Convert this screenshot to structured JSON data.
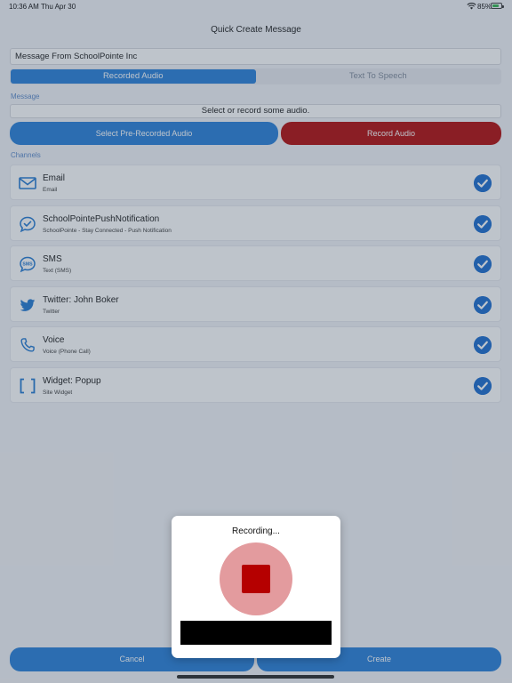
{
  "status_bar": {
    "time": "10:36 AM",
    "date": "Thu Apr 30",
    "battery": "85%"
  },
  "nav": {
    "title": "Quick Create Message"
  },
  "form": {
    "name_value": "Message From SchoolPointe Inc",
    "segments": [
      {
        "label": "Recorded Audio",
        "active": true
      },
      {
        "label": "Text To Speech",
        "active": false
      }
    ],
    "message_label": "Message",
    "audio_status": "Select or record some audio.",
    "select_button": "Select Pre-Recorded Audio",
    "record_button": "Record Audio",
    "channels_label": "Channels"
  },
  "channels": [
    {
      "icon": "envelope-icon",
      "title": "Email",
      "subtitle": "Email",
      "checked": true
    },
    {
      "icon": "chat-check-icon",
      "title": "SchoolPointePushNotification",
      "subtitle": "SchoolPointe - Stay Connected - Push Notification",
      "checked": true
    },
    {
      "icon": "sms-bubble-icon",
      "title": "SMS",
      "subtitle": "Text (SMS)",
      "checked": true
    },
    {
      "icon": "twitter-bird-icon",
      "title": "Twitter: John Boker",
      "subtitle": "Twitter",
      "checked": true
    },
    {
      "icon": "phone-icon",
      "title": "Voice",
      "subtitle": "Voice (Phone Call)",
      "checked": true
    },
    {
      "icon": "brackets-icon",
      "title": "Widget: Popup",
      "subtitle": "Site Widget",
      "checked": true
    }
  ],
  "footer": {
    "cancel": "Cancel",
    "create": "Create"
  },
  "recording_modal": {
    "title": "Recording...",
    "stop_icon": "stop-square-icon"
  },
  "colors": {
    "accent": "#1f7ad8",
    "record": "#b00000",
    "check": "#1166cc",
    "section_label": "#5585c8"
  }
}
